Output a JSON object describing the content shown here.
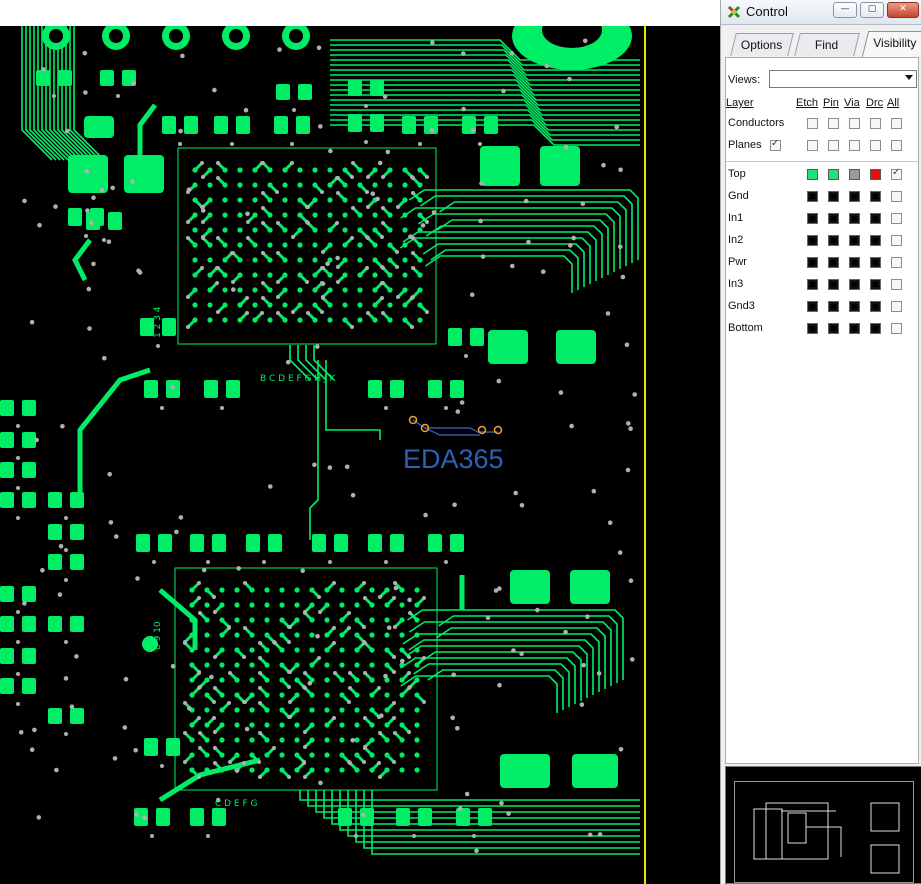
{
  "app": {
    "window_title": "Control"
  },
  "window_controls": {
    "minimize": "—",
    "maximize": "▢",
    "close": "✕"
  },
  "tabs": [
    {
      "label": "Options",
      "active": false
    },
    {
      "label": "Find",
      "active": false
    },
    {
      "label": "Visibility",
      "active": true
    }
  ],
  "visibility": {
    "views_label": "Views:",
    "views_value": "",
    "columns": {
      "layer": "Layer",
      "etch": "Etch",
      "pin": "Pin",
      "via": "Via",
      "drc": "Drc",
      "all": "All"
    },
    "global_rows": [
      {
        "label": "Conductors",
        "checked": [
          false,
          false,
          false,
          false,
          false
        ]
      },
      {
        "label": "Planes",
        "checked": [
          true,
          false,
          false,
          false,
          false
        ]
      }
    ],
    "layers": [
      {
        "label": "Top",
        "colors": [
          "#22e07a",
          "#22e07a",
          "#9a9a9a",
          "#e01010"
        ],
        "all_checked": true
      },
      {
        "label": "Gnd",
        "colors": [
          "black",
          "black",
          "black",
          "black"
        ],
        "all_checked": false
      },
      {
        "label": "In1",
        "colors": [
          "black",
          "black",
          "black",
          "black"
        ],
        "all_checked": false
      },
      {
        "label": "In2",
        "colors": [
          "black",
          "black",
          "black",
          "black"
        ],
        "all_checked": false
      },
      {
        "label": "Pwr",
        "colors": [
          "black",
          "black",
          "black",
          "black"
        ],
        "all_checked": false
      },
      {
        "label": "In3",
        "colors": [
          "black",
          "black",
          "black",
          "black"
        ],
        "all_checked": false
      },
      {
        "label": "Gnd3",
        "colors": [
          "black",
          "black",
          "black",
          "black"
        ],
        "all_checked": false
      },
      {
        "label": "Bottom",
        "colors": [
          "black",
          "black",
          "black",
          "black"
        ],
        "all_checked": false
      }
    ]
  },
  "canvas": {
    "watermark": "EDA365",
    "trace_color": "#00ee66",
    "via_color": "#b0b0b0",
    "boundary_color": "#e6e600",
    "silkscreen_marks_top": "B C D E F G H J K",
    "silkscreen_marks_bottom": "C D E F G",
    "silkscreen_marks_left": "1 2 3 4",
    "silkscreen_marks_left2": "8 9 10"
  }
}
